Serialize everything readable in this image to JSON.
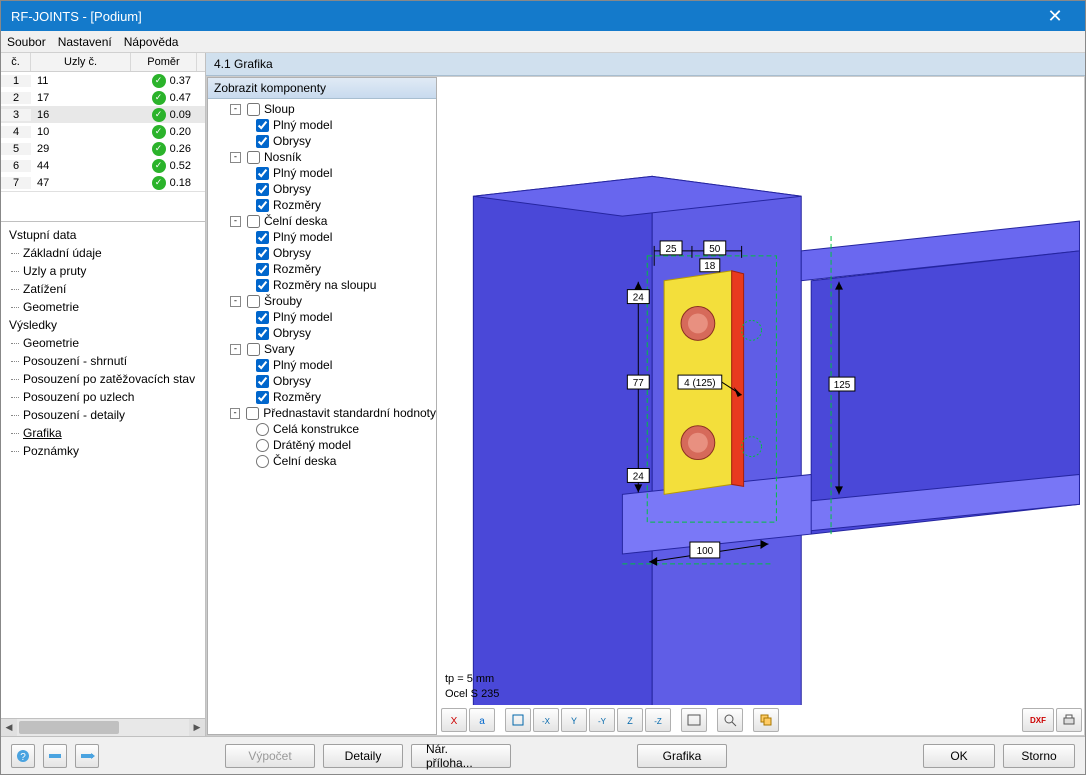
{
  "title": "RF-JOINTS - [Podium]",
  "menu": [
    "Soubor",
    "Nastavení",
    "Nápověda"
  ],
  "nodes_table": {
    "headers": [
      "č.",
      "Uzly č.",
      "Poměr"
    ],
    "rows": [
      {
        "n": 1,
        "node": 11,
        "ratio": "0.37"
      },
      {
        "n": 2,
        "node": 17,
        "ratio": "0.47"
      },
      {
        "n": 3,
        "node": 16,
        "ratio": "0.09",
        "sel": true
      },
      {
        "n": 4,
        "node": 10,
        "ratio": "0.20"
      },
      {
        "n": 5,
        "node": 29,
        "ratio": "0.26"
      },
      {
        "n": 6,
        "node": 44,
        "ratio": "0.52"
      },
      {
        "n": 7,
        "node": 47,
        "ratio": "0.18"
      }
    ]
  },
  "nav": {
    "group1": "Vstupní data",
    "items1": [
      "Základní údaje",
      "Uzly a pruty",
      "Zatížení",
      "Geometrie"
    ],
    "group2": "Výsledky",
    "items2": [
      "Geometrie",
      "Posouzení - shrnutí",
      "Posouzení po zatěžovacích stav",
      "Posouzení po uzlech",
      "Posouzení - detaily",
      "Grafika",
      "Poznámky"
    ],
    "selected": "Grafika"
  },
  "section_title": "4.1 Grafika",
  "tree_title": "Zobrazit komponenty",
  "tree": [
    {
      "label": "Sloup",
      "checked": false,
      "open": true,
      "children": [
        {
          "label": "Plný model",
          "checked": true
        },
        {
          "label": "Obrysy",
          "checked": true
        }
      ]
    },
    {
      "label": "Nosník",
      "checked": false,
      "open": true,
      "children": [
        {
          "label": "Plný model",
          "checked": true
        },
        {
          "label": "Obrysy",
          "checked": true
        },
        {
          "label": "Rozměry",
          "checked": true
        }
      ]
    },
    {
      "label": "Čelní deska",
      "checked": false,
      "open": true,
      "children": [
        {
          "label": "Plný model",
          "checked": true
        },
        {
          "label": "Obrysy",
          "checked": true
        },
        {
          "label": "Rozměry",
          "checked": true
        },
        {
          "label": "Rozměry na sloupu",
          "checked": true
        }
      ]
    },
    {
      "label": "Šrouby",
      "checked": false,
      "open": true,
      "children": [
        {
          "label": "Plný model",
          "checked": true
        },
        {
          "label": "Obrysy",
          "checked": true
        }
      ]
    },
    {
      "label": "Svary",
      "checked": false,
      "open": true,
      "children": [
        {
          "label": "Plný model",
          "checked": true
        },
        {
          "label": "Obrysy",
          "checked": true
        },
        {
          "label": "Rozměry",
          "checked": true
        }
      ]
    },
    {
      "label": "Přednastavit standardní hodnoty",
      "radio_group": true,
      "open": true,
      "children": [
        {
          "label": "Celá konstrukce",
          "radio": true
        },
        {
          "label": "Drátěný model",
          "radio": true
        },
        {
          "label": "Čelní deska",
          "radio": true
        }
      ]
    }
  ],
  "dims": {
    "top1": "25",
    "top2": "50",
    "v18": "18",
    "left1": "24",
    "left2": "77",
    "left3": "24",
    "right": "125",
    "bolt_label": "4 (125)",
    "bottom": "100"
  },
  "info_lines": [
    "tp = 5 mm",
    "Ocel S 235"
  ],
  "buttons": {
    "vypocet": "Výpočet",
    "detaily": "Detaily",
    "priloha": "Nár. příloha...",
    "grafika": "Grafika",
    "ok": "OK",
    "storno": "Storno"
  },
  "dxf_label": "DXF"
}
